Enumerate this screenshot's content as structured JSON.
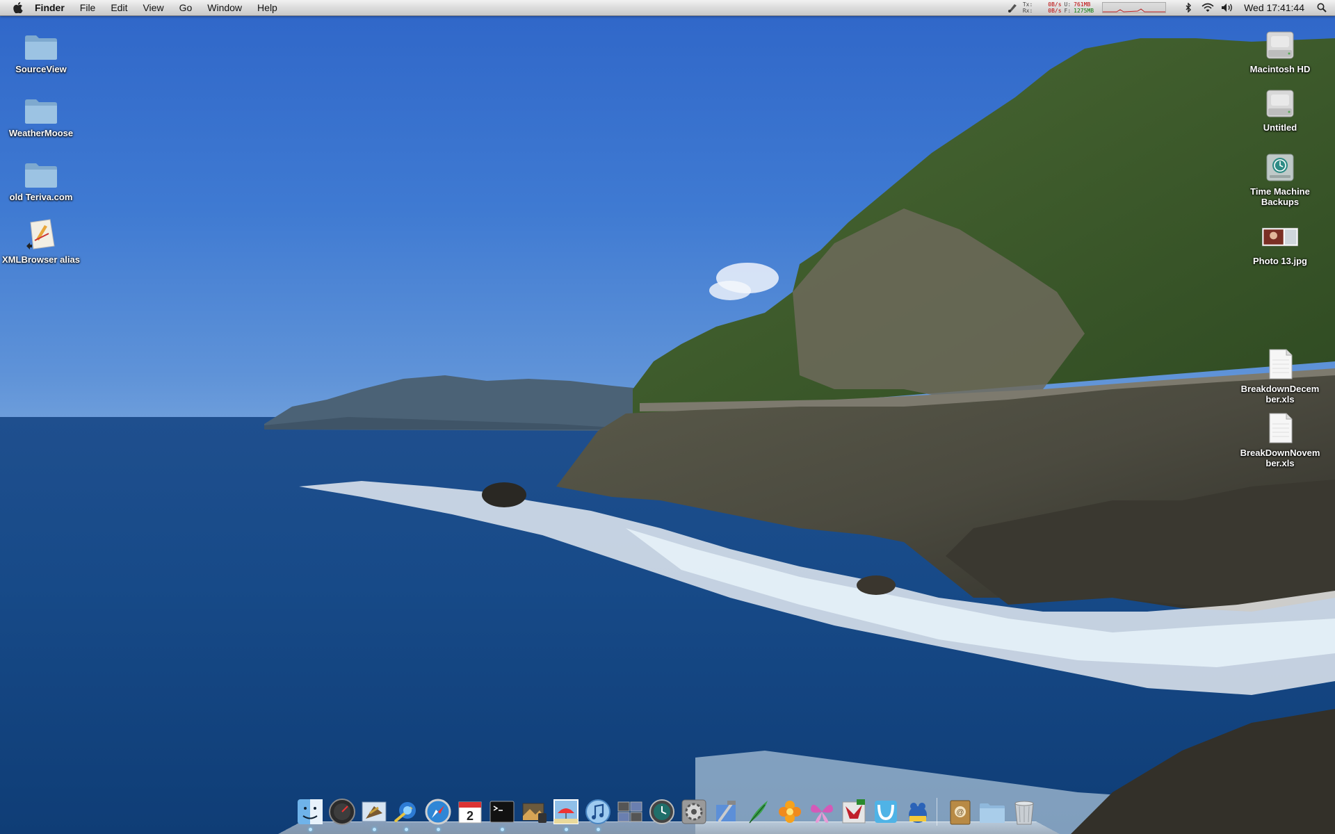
{
  "menubar": {
    "app_name": "Finder",
    "items": [
      "File",
      "Edit",
      "View",
      "Go",
      "Window",
      "Help"
    ],
    "net": {
      "tx_label": "Tx:",
      "rx_label": "Rx:",
      "tx_rate": "0B/s",
      "rx_rate": "0B/s",
      "used_label": "U:",
      "free_label": "F:",
      "used_mem": "761MB",
      "free_mem": "1275MB"
    },
    "clock": "Wed 17:41:44",
    "icons": [
      "apple-icon",
      "script-icon",
      "bluetooth-icon",
      "wifi-icon",
      "volume-icon",
      "spotlight-icon"
    ]
  },
  "desktop_left": [
    {
      "label": "SourceView",
      "icon": "folder-icon"
    },
    {
      "label": "WeatherMoose",
      "icon": "folder-icon"
    },
    {
      "label": "old Teriva.com",
      "icon": "folder-icon"
    },
    {
      "label": "XMLBrowser alias",
      "icon": "xml-app-alias-icon"
    }
  ],
  "desktop_right": [
    {
      "label": "Macintosh HD",
      "icon": "hard-drive-icon"
    },
    {
      "label": "Untitled",
      "icon": "hard-drive-icon"
    },
    {
      "label": "Time Machine Backups",
      "icon": "time-machine-drive-icon"
    },
    {
      "label": "Photo 13.jpg",
      "icon": "photo-file-icon"
    },
    {
      "label": "BreakdownDecember.xls",
      "icon": "xls-file-icon"
    },
    {
      "label": "BreakDownNovember.xls",
      "icon": "xls-file-icon"
    }
  ],
  "dock": {
    "apps": [
      {
        "name": "finder",
        "running": true
      },
      {
        "name": "dashboard",
        "running": false
      },
      {
        "name": "mail",
        "running": true
      },
      {
        "name": "network-tool",
        "running": true
      },
      {
        "name": "safari",
        "running": true
      },
      {
        "name": "ical",
        "running": false,
        "text": "2"
      },
      {
        "name": "terminal",
        "running": true
      },
      {
        "name": "iphoto",
        "running": false
      },
      {
        "name": "preview",
        "running": true
      },
      {
        "name": "itunes",
        "running": true
      },
      {
        "name": "spaces",
        "running": false
      },
      {
        "name": "time-machine",
        "running": false
      },
      {
        "name": "system-preferences",
        "running": false
      },
      {
        "name": "xcode",
        "running": false
      },
      {
        "name": "quill-app",
        "running": false
      },
      {
        "name": "flower-app",
        "running": false
      },
      {
        "name": "butterfly-app",
        "running": false
      },
      {
        "name": "flashcard-app",
        "running": false
      },
      {
        "name": "textwrangler",
        "running": false
      },
      {
        "name": "adium",
        "running": false
      }
    ],
    "docs": [
      "address-book",
      "folder-stack",
      "trash"
    ]
  },
  "colors": {
    "dock_running_dot": "#b9e3ff",
    "label_text": "#ffffff"
  }
}
